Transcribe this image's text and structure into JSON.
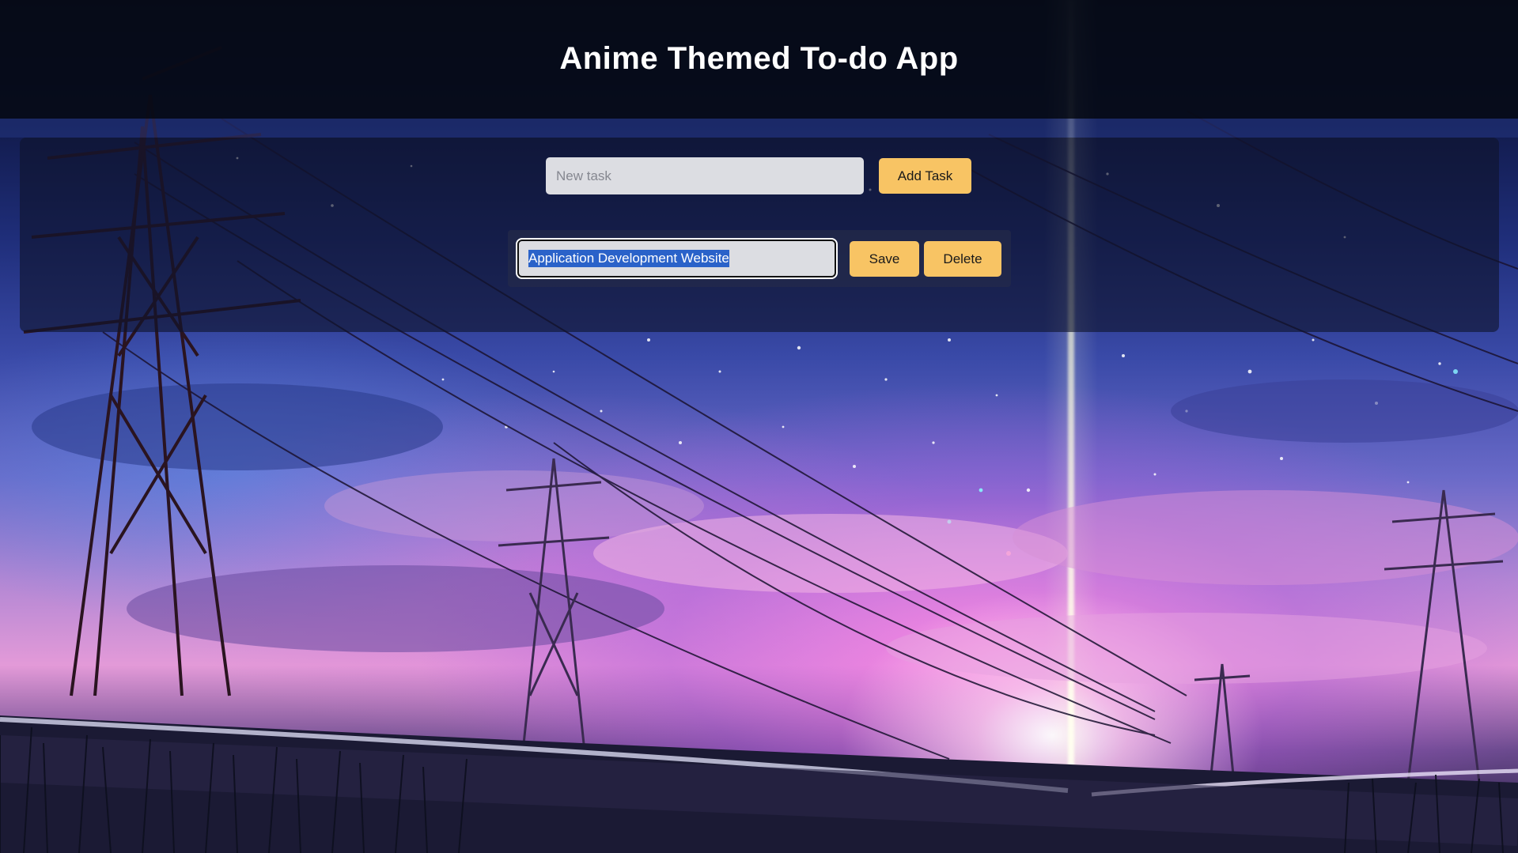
{
  "header": {
    "title": "Anime Themed To-do App"
  },
  "add_task": {
    "placeholder": "New task",
    "value": "",
    "button_label": "Add Task"
  },
  "tasks": [
    {
      "text": "Application Development Website",
      "editing": true,
      "text_selected": true,
      "save_label": "Save",
      "delete_label": "Delete"
    }
  ],
  "colors": {
    "button": "#f8c464",
    "header": "#060a16",
    "input": "#dcdde2",
    "selection": "#2a62c9"
  }
}
